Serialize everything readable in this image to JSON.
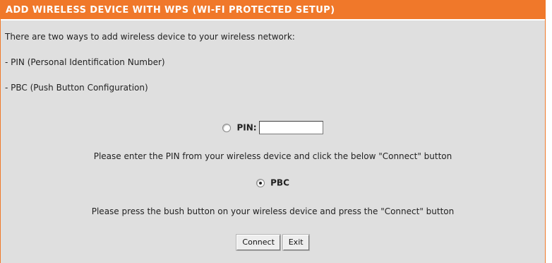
{
  "header": {
    "title": "ADD WIRELESS DEVICE WITH WPS (WI-FI PROTECTED SETUP)"
  },
  "intro": {
    "line1": "There are two ways to add wireless device to your wireless network:",
    "line2": "- PIN (Personal Identification Number)",
    "line3": "- PBC (Push Button Configuration)"
  },
  "pin_option": {
    "label": "PIN:",
    "selected": false,
    "input_value": "",
    "instruction": "Please enter the PIN from your wireless device and click the below \"Connect\" button"
  },
  "pbc_option": {
    "label": "PBC",
    "selected": true,
    "instruction": "Please press the bush button on your wireless device and press the \"Connect\" button"
  },
  "buttons": {
    "connect": "Connect",
    "exit": "Exit"
  },
  "colors": {
    "header_bg": "#f0782a",
    "panel_bg": "#dfdfdf",
    "header_text": "#ffffff"
  }
}
